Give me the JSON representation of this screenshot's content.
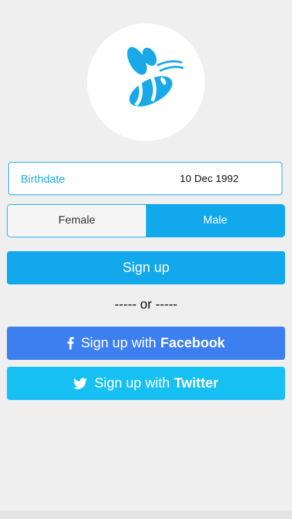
{
  "logo": {
    "icon": "bee-icon",
    "color": "#19a9e8"
  },
  "birthdate": {
    "label": "Birthdate",
    "value": "10 Dec 1992"
  },
  "gender": {
    "options": [
      "Female",
      "Male"
    ],
    "selected": "Male"
  },
  "signup": {
    "label": "Sign up"
  },
  "divider": {
    "text": "----- or -----"
  },
  "facebook": {
    "prefix": "Sign up with",
    "brand": "Facebook",
    "icon": "facebook-icon",
    "color": "#3e7ff0"
  },
  "twitter": {
    "prefix": "Sign up with",
    "brand": "Twitter",
    "icon": "twitter-icon",
    "color": "#17c0f2"
  },
  "colors": {
    "accent": "#12a8ec",
    "background": "#efefef"
  }
}
